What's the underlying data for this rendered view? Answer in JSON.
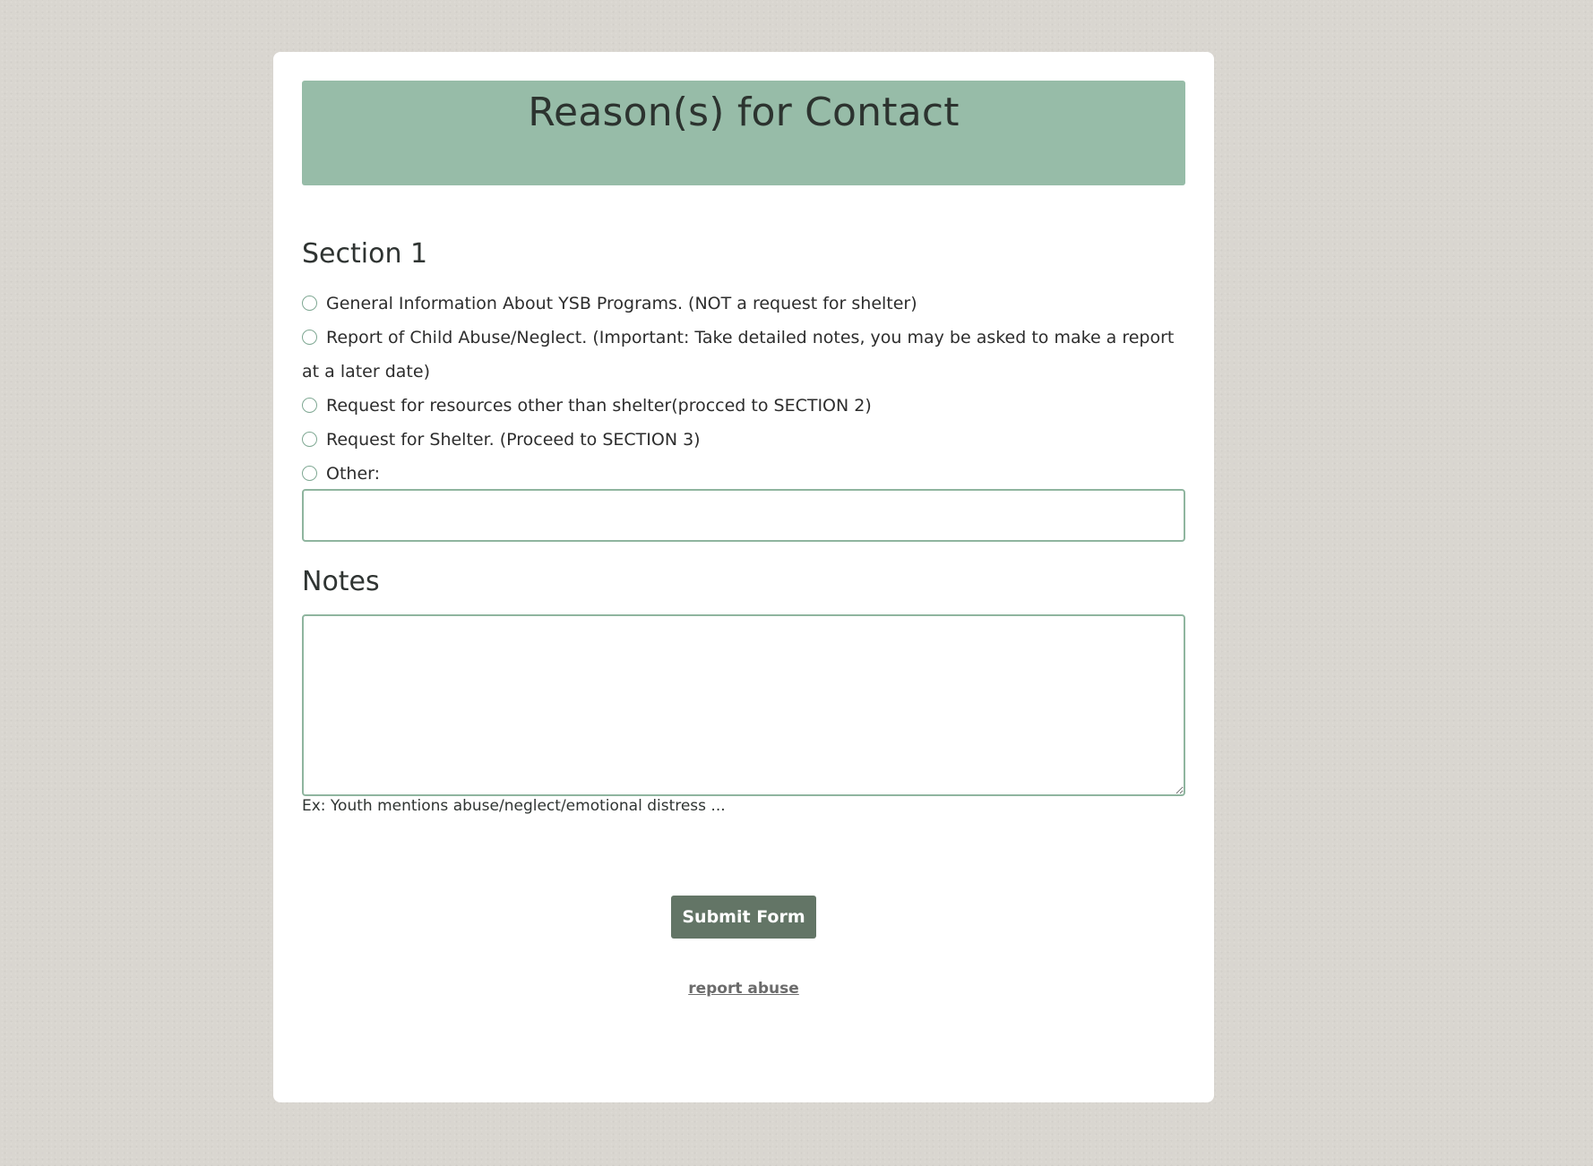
{
  "header": {
    "title": "Reason(s) for Contact"
  },
  "section1": {
    "title": "Section 1",
    "options": [
      {
        "label": "General Information About YSB Programs. (NOT a request for shelter)",
        "selected": false
      },
      {
        "label": "Report of Child Abuse/Neglect. (Important: Take detailed notes, you may be asked to make a report at a later date)",
        "selected": false
      },
      {
        "label": "Request for resources other than shelter(procced to SECTION 2)",
        "selected": false
      },
      {
        "label": "Request for Shelter. (Proceed to SECTION 3)",
        "selected": false
      },
      {
        "label": "Other:",
        "selected": false
      }
    ],
    "other_value": ""
  },
  "notes": {
    "title": "Notes",
    "value": "",
    "hint": "Ex: Youth mentions abuse/neglect/emotional distress ..."
  },
  "actions": {
    "submit_label": "Submit Form",
    "report_label": "report abuse"
  },
  "colors": {
    "background": "#d9d6d0",
    "banner": "#97bca8",
    "accent_border": "#8fb59f",
    "button": "#637566"
  }
}
